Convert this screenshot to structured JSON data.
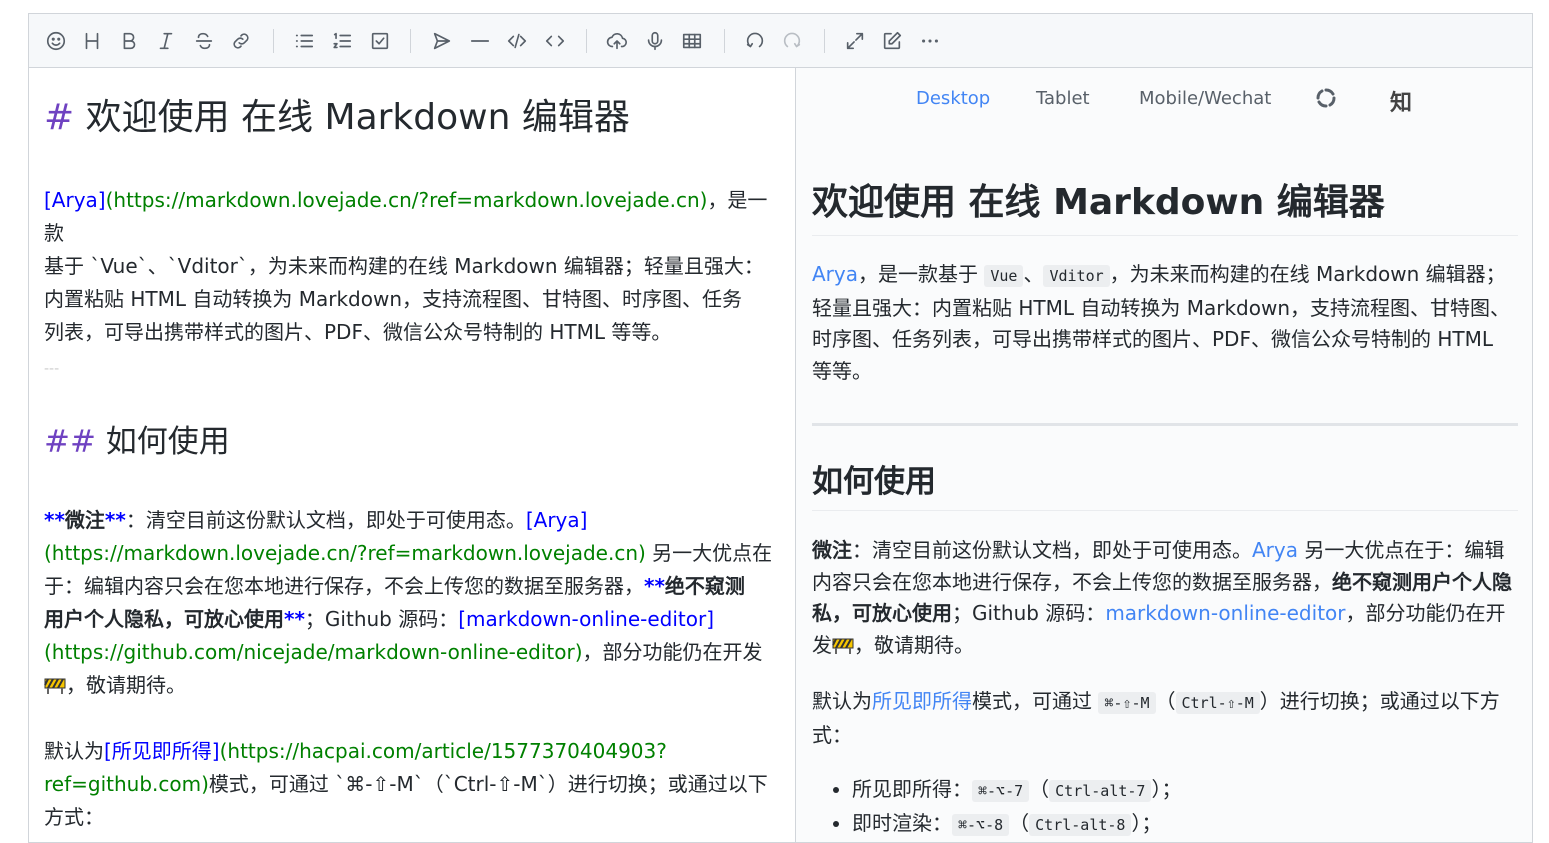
{
  "toolbar": {
    "icons": [
      "emoji-icon",
      "heading-icon",
      "bold-icon",
      "italic-icon",
      "strike-icon",
      "link-icon",
      "bullet-list-icon",
      "ordered-list-icon",
      "check-list-icon",
      "quote-icon",
      "line-icon",
      "inline-code-icon",
      "code-block-icon",
      "upload-icon",
      "record-icon",
      "table-icon",
      "undo-icon",
      "redo-icon",
      "fullscreen-icon",
      "edit-mode-icon",
      "more-icon"
    ]
  },
  "editor": {
    "h1_marker": "#",
    "h1_text": " 欢迎使用 在线 Markdown 编辑器",
    "p1_link": "[Arya]",
    "p1_url": "(https://markdown.lovejade.cn/?ref=markdown.lovejade.cn)",
    "p1_a": "，是一款",
    "p1_b": "基于 `Vue`、`Vditor`，为未来而构建的在线 Markdown 编辑器；轻量且强大：",
    "p1_c": "内置粘贴 HTML 自动转换为 Markdown，支持流程图、甘特图、时序图、任务",
    "p1_d": "列表，可导出携带样式的图片、PDF、微信公众号特制的 HTML 等等。",
    "hr": "---",
    "h2_marker": "##",
    "h2_text": " 如何使用",
    "p2_bm1": "**",
    "p2_bold": "微注",
    "p2_bm2": "**",
    "p2_a": "：清空目前这份默认文档，即处于可使用态。",
    "p2_link": "[Arya]",
    "p2_url": "(https://markdown.lovejade.cn/?ref=markdown.lovejade.cn)",
    "p2_b": " 另一大优点在",
    "p2_c": "于：编辑内容只会在您本地进行保存，不会上传您的数据至服务器，",
    "p2_bm3": "**",
    "p2_bold2a": "绝不窥测",
    "p2_bold2b": "用户个人隐私，可放心使用",
    "p2_bm4": "**",
    "p2_d": "；Github 源码：",
    "p2_link2": "[markdown-online-editor]",
    "p2_url2": "(https://github.com/nicejade/markdown-online-editor)",
    "p2_e": "，部分功能仍在开发",
    "p2_f": "，敬请期待。",
    "p3_a": "默认为",
    "p3_link": "[所见即所得]",
    "p3_url_a": "(https://hacpai.com/article/1577370404903?",
    "p3_url_b": "ref=github.com)",
    "p3_b": "模式，可通过 `⌘-⇧-M`（`Ctrl-⇧-M`）进行切换；或通过以下",
    "p3_c": "方式："
  },
  "preview": {
    "tabs": [
      "Desktop",
      "Tablet",
      "Mobile/Wechat"
    ],
    "zhihu_label": "知",
    "h1": "欢迎使用 在线 Markdown 编辑器",
    "p1_link": "Arya",
    "p1_a": "，是一款基于 ",
    "p1_code1": "Vue",
    "p1_sep": "、",
    "p1_code2": "Vditor",
    "p1_b": "，为未来而构建的在线 Markdown 编辑器；轻量且强大：内置粘贴 HTML 自动转换为 Markdown，支持流程图、甘特图、时序图、任务列表，可导出携带样式的图片、PDF、微信公众号特制的 HTML 等等。",
    "h2": "如何使用",
    "p2_bold": "微注",
    "p2_a": "：清空目前这份默认文档，即处于可使用态。",
    "p2_link": "Arya",
    "p2_b": " 另一大优点在于：编辑内容只会在您本地进行保存，不会上传您的数据至服务器，",
    "p2_bold2": "绝不窥测用户个人隐私，可放心使用",
    "p2_c": "；Github 源码：",
    "p2_link2": "markdown-online-editor",
    "p2_d": "，部分功能仍在开发",
    "p2_e": "，敬请期待。",
    "p3_a": "默认为",
    "p3_link": "所见即所得",
    "p3_b": "模式，可通过 ",
    "p3_code1": "⌘-⇧-M",
    "p3_paren1": "（",
    "p3_code2": "Ctrl-⇧-M",
    "p3_c": "）进行切换；或通过以下方式：",
    "li1_label": "所见即所得：",
    "li1_code1": "⌘-⌥-7",
    "li1_mid": "（",
    "li1_code2": "Ctrl-alt-7",
    "li1_end": "）；",
    "li2_label": "即时渲染：",
    "li2_code1": "⌘-⌥-8",
    "li2_mid": "（",
    "li2_code2": "Ctrl-alt-8",
    "li2_end": "）；"
  },
  "colors": {
    "link": "#4285f4",
    "md_marker": "#6f42c1",
    "md_url": "#008000",
    "md_link": "#0000ff"
  }
}
